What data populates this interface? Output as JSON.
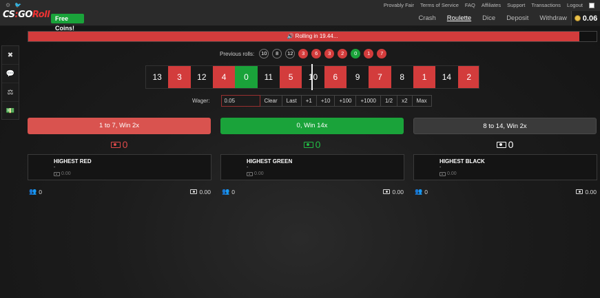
{
  "topbar": {
    "links": [
      "Provably Fair",
      "Terms of Service",
      "FAQ",
      "Affiliates",
      "Support",
      "Transactions",
      "Logout"
    ],
    "nav": [
      "Crash",
      "Roulette",
      "Dice",
      "Deposit",
      "Withdraw"
    ],
    "active_nav": "Roulette",
    "free_coins": "Free Coins!",
    "balance": "0.06"
  },
  "progress": {
    "text": "🔊 Rolling in 19.44...",
    "fraction": 0.97
  },
  "previous_rolls": {
    "label": "Previous rolls:",
    "rolls": [
      {
        "n": "10",
        "c": "black"
      },
      {
        "n": "8",
        "c": "black"
      },
      {
        "n": "12",
        "c": "black"
      },
      {
        "n": "3",
        "c": "red"
      },
      {
        "n": "6",
        "c": "red"
      },
      {
        "n": "3",
        "c": "red"
      },
      {
        "n": "2",
        "c": "red"
      },
      {
        "n": "0",
        "c": "green"
      },
      {
        "n": "1",
        "c": "red"
      },
      {
        "n": "7",
        "c": "red"
      }
    ]
  },
  "strip": [
    {
      "n": "13",
      "c": "black"
    },
    {
      "n": "3",
      "c": "red"
    },
    {
      "n": "12",
      "c": "black"
    },
    {
      "n": "4",
      "c": "red"
    },
    {
      "n": "0",
      "c": "green"
    },
    {
      "n": "11",
      "c": "black"
    },
    {
      "n": "5",
      "c": "red"
    },
    {
      "n": "10",
      "c": "black"
    },
    {
      "n": "6",
      "c": "red"
    },
    {
      "n": "9",
      "c": "black"
    },
    {
      "n": "7",
      "c": "red"
    },
    {
      "n": "8",
      "c": "black"
    },
    {
      "n": "1",
      "c": "red"
    },
    {
      "n": "14",
      "c": "black"
    },
    {
      "n": "2",
      "c": "red"
    }
  ],
  "wager": {
    "label": "Wager:",
    "value": "0.05",
    "buttons": [
      "Clear",
      "Last",
      "+1",
      "+10",
      "+100",
      "+1000",
      "1/2",
      "x2",
      "Max"
    ]
  },
  "bets": {
    "red": {
      "label": "1 to 7, Win 2x",
      "total": "0",
      "title": "HIGHEST RED",
      "dash": "-",
      "amount": "0.00",
      "users": "0",
      "sum": "0.00"
    },
    "green": {
      "label": "0, Win 14x",
      "total": "0",
      "title": "HIGHEST GREEN",
      "dash": "-",
      "amount": "0.00",
      "users": "0",
      "sum": "0.00"
    },
    "black": {
      "label": "8 to 14, Win 2x",
      "total": "0",
      "title": "HIGHEST BLACK",
      "dash": "-",
      "amount": "0.00",
      "users": "0",
      "sum": "0.00"
    }
  },
  "colors": {
    "red": "#d33c3c",
    "green": "#1aa33a",
    "black": "#1a1a1a"
  }
}
